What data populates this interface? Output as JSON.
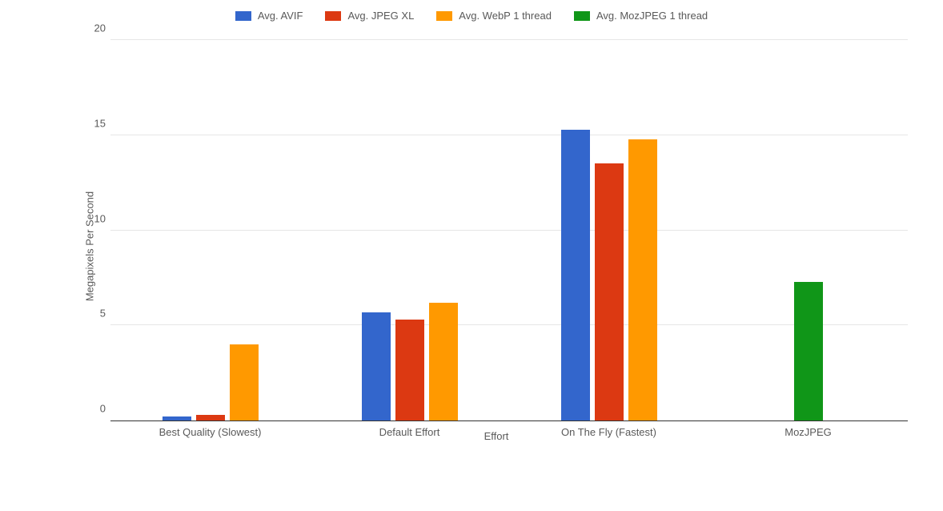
{
  "chart_data": {
    "type": "bar",
    "title": "",
    "xlabel": "Effort",
    "ylabel": "Megapixels Per Second",
    "ylim": [
      0,
      20
    ],
    "yticks": [
      0,
      5,
      10,
      15,
      20
    ],
    "categories": [
      "Best Quality (Slowest)",
      "Default Effort",
      "On The Fly (Fastest)",
      "MozJPEG"
    ],
    "series": [
      {
        "name": "Avg. AVIF",
        "color": "#3366CC",
        "values": [
          0.2,
          5.7,
          15.3,
          null
        ]
      },
      {
        "name": "Avg. JPEG XL",
        "color": "#DC3912",
        "values": [
          0.3,
          5.3,
          13.5,
          null
        ]
      },
      {
        "name": "Avg. WebP 1 thread",
        "color": "#FF9900",
        "values": [
          4.0,
          6.2,
          14.8,
          null
        ]
      },
      {
        "name": "Avg. MozJPEG 1 thread",
        "color": "#109618",
        "values": [
          null,
          null,
          null,
          7.3
        ]
      }
    ]
  },
  "legend": {
    "items": [
      {
        "label": "Avg. AVIF",
        "color": "#3366CC"
      },
      {
        "label": "Avg. JPEG XL",
        "color": "#DC3912"
      },
      {
        "label": "Avg. WebP 1 thread",
        "color": "#FF9900"
      },
      {
        "label": "Avg. MozJPEG 1 thread",
        "color": "#109618"
      }
    ]
  }
}
